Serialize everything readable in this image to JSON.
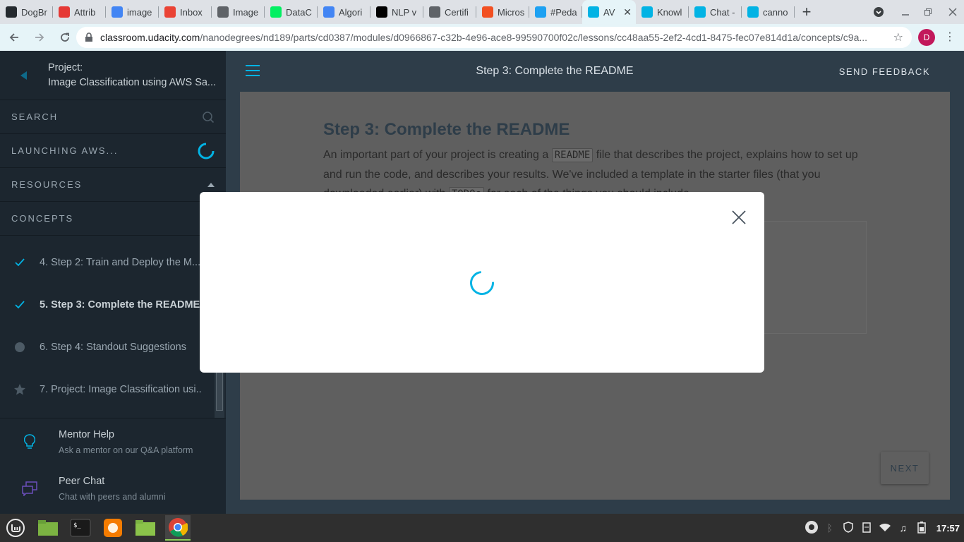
{
  "browser": {
    "tabs": [
      {
        "label": "DogBr",
        "icon": "github-icon",
        "color": "#24292e"
      },
      {
        "label": "Attrib",
        "icon": "opera-icon",
        "color": "#e53935"
      },
      {
        "label": "image",
        "icon": "google-icon",
        "color": "#4285f4"
      },
      {
        "label": "Inbox",
        "icon": "gmail-icon",
        "color": "#ea4335"
      },
      {
        "label": "Image",
        "icon": "doc-icon",
        "color": "#5f6368"
      },
      {
        "label": "DataC",
        "icon": "datacamp-icon",
        "color": "#03ef62"
      },
      {
        "label": "Algori",
        "icon": "google-icon",
        "color": "#4285f4"
      },
      {
        "label": "NLP v",
        "icon": "medium-icon",
        "color": "#000000"
      },
      {
        "label": "Certifi",
        "icon": "file-icon",
        "color": "#5f6368"
      },
      {
        "label": "Micros",
        "icon": "microsoft-icon",
        "color": "#f25022"
      },
      {
        "label": "#Peda",
        "icon": "twitter-icon",
        "color": "#1da1f2"
      },
      {
        "label": "AV",
        "icon": "udacity-icon",
        "color": "#02b3e4",
        "active": true
      },
      {
        "label": "Knowl",
        "icon": "udacity-icon",
        "color": "#02b3e4"
      },
      {
        "label": "Chat -",
        "icon": "udacity-icon",
        "color": "#02b3e4"
      },
      {
        "label": "canno",
        "icon": "udacity-icon",
        "color": "#02b3e4"
      }
    ],
    "url_host": "classroom.udacity.com",
    "url_path": "/nanodegrees/nd189/parts/cd0387/modules/d0966867-c32b-4e96-ace8-99590700f02c/lessons/cc48aa55-2ef2-4cd1-8475-fec07e814d1a/concepts/c9a...",
    "profile_initial": "D"
  },
  "sidebar": {
    "project_label": "Project:",
    "project_name": "Image Classification using AWS Sa...",
    "search_label": "SEARCH",
    "launching_label": "LAUNCHING AWS...",
    "resources_label": "RESOURCES",
    "concepts_label": "CONCEPTS",
    "concepts": [
      {
        "label": "4. Step 2: Train and Deploy the M...",
        "icon": "check-icon",
        "status": "done"
      },
      {
        "label": "5. Step 3: Complete the README",
        "icon": "check-icon",
        "status": "current"
      },
      {
        "label": "6. Step 4: Standout Suggestions",
        "icon": "dot-icon",
        "status": "todo"
      },
      {
        "label": "7. Project: Image Classification usi...",
        "icon": "star-icon",
        "status": "project"
      }
    ],
    "help": [
      {
        "title": "Mentor Help",
        "subtitle": "Ask a mentor on our Q&A platform",
        "icon": "lightbulb-icon"
      },
      {
        "title": "Peer Chat",
        "subtitle": "Chat with peers and alumni",
        "icon": "chat-icon"
      }
    ]
  },
  "main": {
    "header_title": "Step 3: Complete the README",
    "send_feedback": "SEND FEEDBACK",
    "heading": "Step 3: Complete the README",
    "para_1": "An important part of your project is creating a ",
    "code_1": "README",
    "para_2": " file that describes the project, explains how to set up and run the code, and describes your results. We've included a template in the starter files (that you downloaded earlier) with ",
    "code_2": "TODOs",
    "para_3": " for each of the things you should include.",
    "next_label": "NEXT"
  },
  "taskbar": {
    "apps": [
      "mint-menu-icon",
      "files-icon",
      "terminal-icon",
      "firefox-icon",
      "folder-icon",
      "chrome-icon"
    ],
    "clock": "17:57"
  },
  "colors": {
    "accent": "#02b3e4",
    "sidebar_bg": "#1c262f",
    "header_bg": "#2e3d49"
  }
}
